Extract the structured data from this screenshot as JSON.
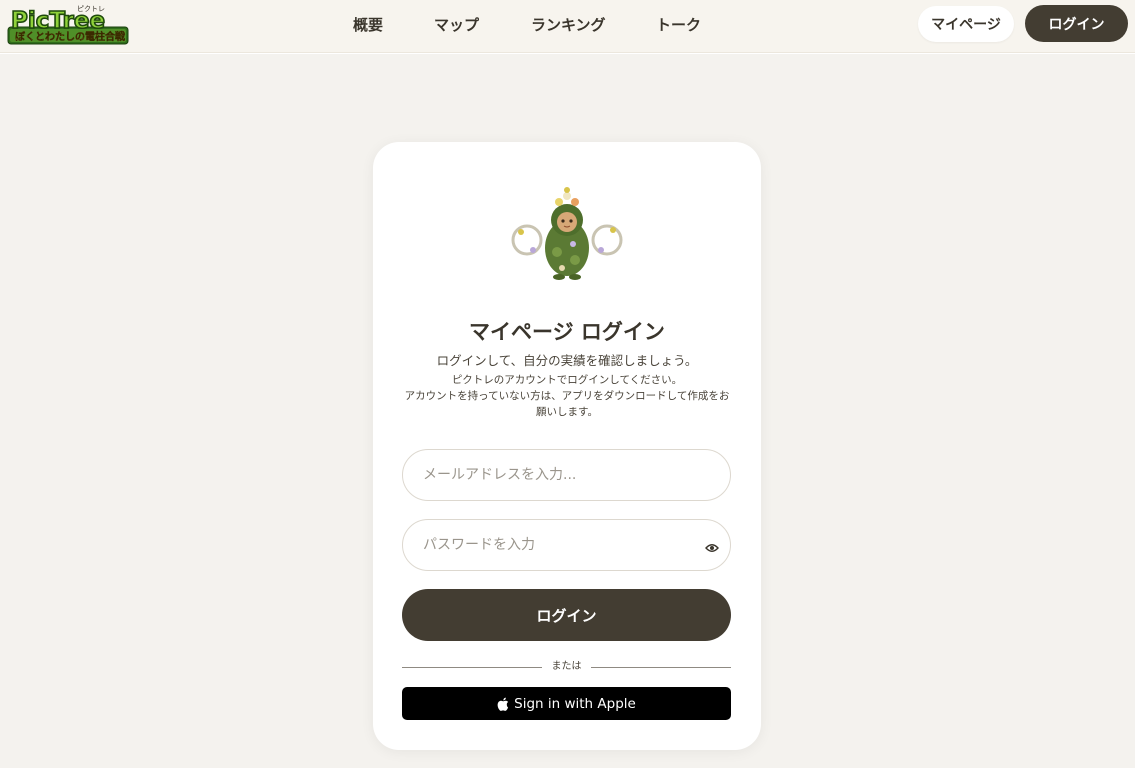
{
  "header": {
    "logo": {
      "brand": "PicTree",
      "ruby": "ピクトレ",
      "tagline": "ぼくとわたしの電柱合戦"
    },
    "nav": [
      {
        "label": "概要"
      },
      {
        "label": "マップ"
      },
      {
        "label": "ランキング"
      },
      {
        "label": "トーク"
      }
    ],
    "mypage_label": "マイページ",
    "login_label": "ログイン"
  },
  "login_card": {
    "title": "マイページ ログイン",
    "subtitle": "ログインして、自分の実績を確認しましょう。",
    "note_line1": "ピクトレのアカウントでログインしてください。",
    "note_line2": "アカウントを持っていない方は、アプリをダウンロードして作成をお願いします。",
    "email_placeholder": "メールアドレスを入力...",
    "password_placeholder": "パスワードを入力",
    "login_button": "ログイン",
    "divider_text": "または",
    "apple_button": "Sign in with Apple"
  },
  "icons": {
    "password_toggle": "eye-icon",
    "apple": "apple-icon",
    "mascot": "mascot-image"
  },
  "colors": {
    "primary": "#433d32",
    "header_bg": "#f7f4ee",
    "page_bg": "#f4f2ee",
    "apple_button": "#000000"
  }
}
